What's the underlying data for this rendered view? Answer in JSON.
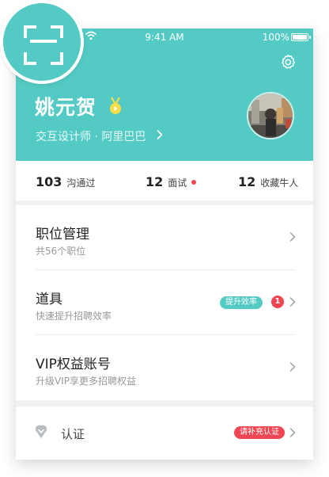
{
  "status_bar": {
    "time": "9:41 AM",
    "battery": "100%",
    "battery_level": 1.0
  },
  "profile": {
    "name": "姚元贺",
    "subtitle": "交互设计师 · 阿里巴巴",
    "badge_icon": "vip-medal-icon",
    "avatar": "avatar-photo"
  },
  "stats": [
    {
      "value": "103",
      "label": "沟通过"
    },
    {
      "value": "12",
      "label": "面试",
      "has_dot": true
    },
    {
      "value": "12",
      "label": "收藏牛人"
    }
  ],
  "menu": [
    {
      "title": "职位管理",
      "desc": "共56个职位"
    },
    {
      "title": "道具",
      "desc": "快速提升招聘效率",
      "tag": "提升效率",
      "count": "1"
    },
    {
      "title": "VIP权益账号",
      "desc": "升级VIP享更多招聘权益"
    }
  ],
  "certification": {
    "label": "认证",
    "tag": "请补充认证"
  },
  "colors": {
    "brand": "#53cac3",
    "alert": "#f04653",
    "tag_teal": "#53cac3"
  },
  "icons": {
    "scan": "scan-icon",
    "settings": "gear-icon",
    "chevron": "chevron-right-icon",
    "shield": "certification-icon"
  }
}
